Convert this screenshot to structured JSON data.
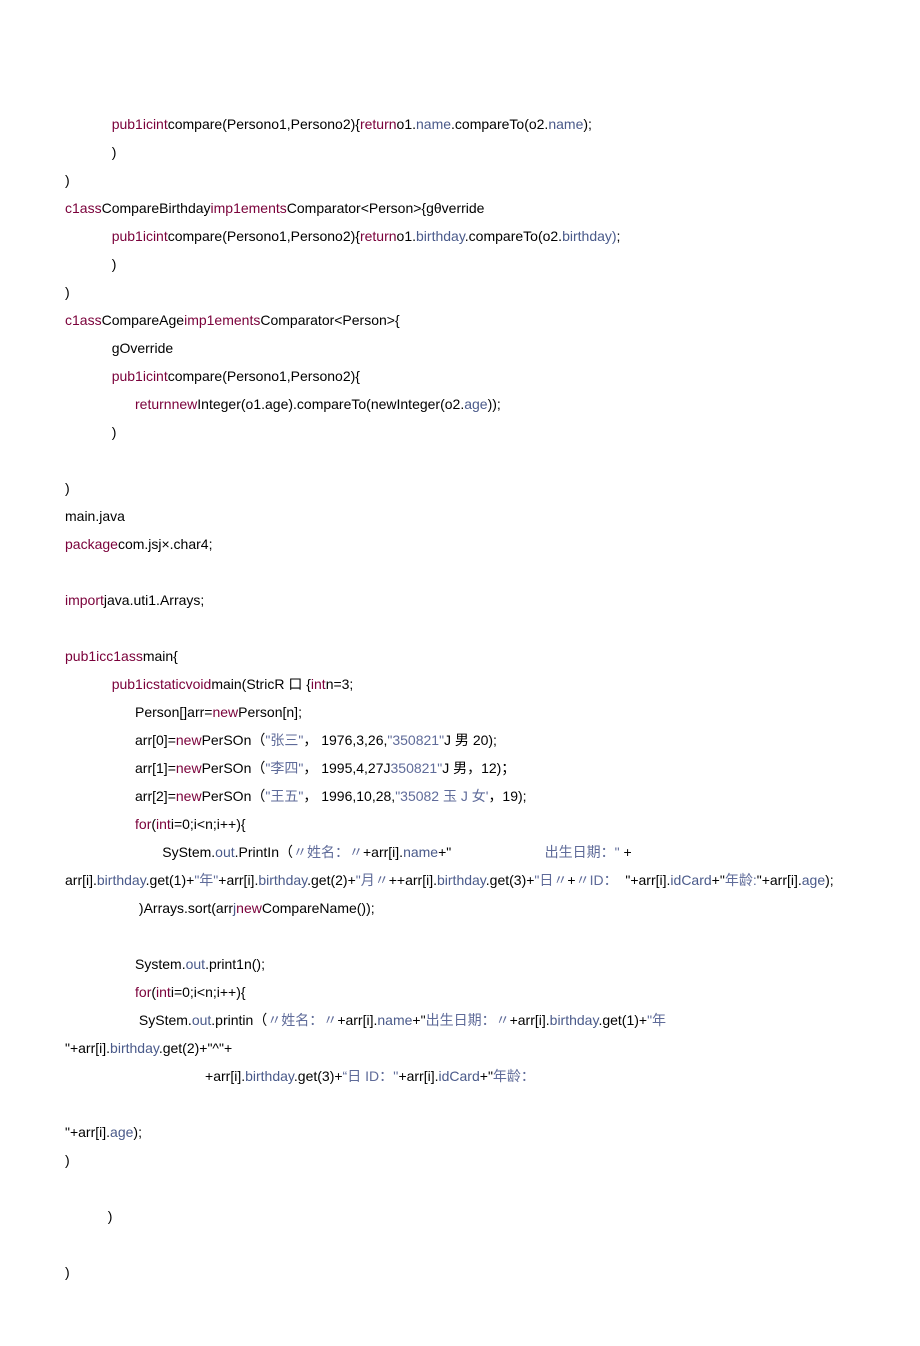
{
  "code_lines": [
    [
      {
        "cls": "plain",
        "txt": "            "
      },
      {
        "cls": "kw",
        "txt": "pub1icint"
      },
      {
        "cls": "plain",
        "txt": "compare(Persono1,Persono2){"
      },
      {
        "cls": "kw",
        "txt": "return"
      },
      {
        "cls": "plain",
        "txt": "o1."
      },
      {
        "cls": "mem",
        "txt": "name"
      },
      {
        "cls": "plain",
        "txt": ".compareTo(o2."
      },
      {
        "cls": "mem",
        "txt": "name"
      },
      {
        "cls": "plain",
        "txt": ");"
      }
    ],
    [
      {
        "cls": "plain",
        "txt": "            )"
      }
    ],
    [
      {
        "cls": "plain",
        "txt": ")"
      }
    ],
    [
      {
        "cls": "kw",
        "txt": "c1ass"
      },
      {
        "cls": "plain",
        "txt": "CompareBirthday"
      },
      {
        "cls": "kw",
        "txt": "imp1ements"
      },
      {
        "cls": "plain",
        "txt": "Comparator<Person>{gθverride"
      }
    ],
    [
      {
        "cls": "plain",
        "txt": "            "
      },
      {
        "cls": "kw",
        "txt": "pub1icint"
      },
      {
        "cls": "plain",
        "txt": "compare(Persono1,Persono2){"
      },
      {
        "cls": "kw",
        "txt": "return"
      },
      {
        "cls": "plain",
        "txt": "o1."
      },
      {
        "cls": "mem",
        "txt": "birthday"
      },
      {
        "cls": "plain",
        "txt": ".compareTo(o2."
      },
      {
        "cls": "mem",
        "txt": "birthday)"
      },
      {
        "cls": "plain",
        "txt": ";"
      }
    ],
    [
      {
        "cls": "plain",
        "txt": "            )"
      }
    ],
    [
      {
        "cls": "plain",
        "txt": ")"
      }
    ],
    [
      {
        "cls": "kw",
        "txt": "c1ass"
      },
      {
        "cls": "plain",
        "txt": "CompareAge"
      },
      {
        "cls": "kw",
        "txt": "imp1ements"
      },
      {
        "cls": "plain",
        "txt": "Comparator<Person>{"
      }
    ],
    [
      {
        "cls": "plain",
        "txt": "            gOverride"
      }
    ],
    [
      {
        "cls": "plain",
        "txt": "            "
      },
      {
        "cls": "kw",
        "txt": "pub1icint"
      },
      {
        "cls": "plain",
        "txt": "compare(Persono1,Persono2){"
      }
    ],
    [
      {
        "cls": "plain",
        "txt": "                  "
      },
      {
        "cls": "kw",
        "txt": "returnnew"
      },
      {
        "cls": "plain",
        "txt": "Integer(o1.age).compareTo(newInteger(o2."
      },
      {
        "cls": "mem",
        "txt": "age"
      },
      {
        "cls": "plain",
        "txt": "));"
      }
    ],
    [
      {
        "cls": "plain",
        "txt": "            )"
      }
    ],
    [
      {
        "cls": "plain",
        "txt": ""
      }
    ],
    [
      {
        "cls": "plain",
        "txt": ")"
      }
    ],
    [
      {
        "cls": "plain",
        "txt": "main.java"
      }
    ],
    [
      {
        "cls": "kw",
        "txt": "package"
      },
      {
        "cls": "plain",
        "txt": "com.jsj×.char4;"
      }
    ],
    [
      {
        "cls": "plain",
        "txt": ""
      }
    ],
    [
      {
        "cls": "kw",
        "txt": "import"
      },
      {
        "cls": "plain",
        "txt": "java.uti1.Arrays;"
      }
    ],
    [
      {
        "cls": "plain",
        "txt": ""
      }
    ],
    [
      {
        "cls": "kw",
        "txt": "pub1icc1ass"
      },
      {
        "cls": "plain",
        "txt": "main{"
      }
    ],
    [
      {
        "cls": "plain",
        "txt": "            "
      },
      {
        "cls": "kw",
        "txt": "pub1icstaticvoid"
      },
      {
        "cls": "plain",
        "txt": "main(StricR 口 {"
      },
      {
        "cls": "kw",
        "txt": "int"
      },
      {
        "cls": "plain",
        "txt": "n=3;"
      }
    ],
    [
      {
        "cls": "plain",
        "txt": "                  Person[]arr="
      },
      {
        "cls": "kw",
        "txt": "new"
      },
      {
        "cls": "plain",
        "txt": "Person[n];"
      }
    ],
    [
      {
        "cls": "plain",
        "txt": "                  arr[0]="
      },
      {
        "cls": "kw",
        "txt": "new"
      },
      {
        "cls": "plain",
        "txt": "PerSOn（"
      },
      {
        "cls": "str",
        "txt": "\"张三\""
      },
      {
        "cls": "plain",
        "txt": "， 1976,3,26,"
      },
      {
        "cls": "str",
        "txt": "\"350821\""
      },
      {
        "cls": "plain",
        "txt": "J 男 20);"
      }
    ],
    [
      {
        "cls": "plain",
        "txt": "                  arr[1]="
      },
      {
        "cls": "kw",
        "txt": "new"
      },
      {
        "cls": "plain",
        "txt": "PerSOn（"
      },
      {
        "cls": "str",
        "txt": "\"李四\""
      },
      {
        "cls": "plain",
        "txt": "， 1995,4,27J"
      },
      {
        "cls": "str",
        "txt": "350821\""
      },
      {
        "cls": "plain",
        "txt": "J 男，12)；"
      }
    ],
    [
      {
        "cls": "plain",
        "txt": "                  arr[2]="
      },
      {
        "cls": "kw",
        "txt": "new"
      },
      {
        "cls": "plain",
        "txt": "PerSOn（"
      },
      {
        "cls": "str",
        "txt": "\"王五\""
      },
      {
        "cls": "plain",
        "txt": "， 1996,10,28,"
      },
      {
        "cls": "str",
        "txt": "\"35082 玉 J 女'"
      },
      {
        "cls": "plain",
        "txt": "，19);"
      }
    ],
    [
      {
        "cls": "plain",
        "txt": "                  "
      },
      {
        "cls": "kw",
        "txt": "for"
      },
      {
        "cls": "plain",
        "txt": "("
      },
      {
        "cls": "kw",
        "txt": "int"
      },
      {
        "cls": "plain",
        "txt": "i=0;i<n;i++){"
      }
    ],
    [
      {
        "cls": "plain",
        "txt": "                         SyStem."
      },
      {
        "cls": "mem",
        "txt": "out"
      },
      {
        "cls": "plain",
        "txt": ".PrintIn（"
      },
      {
        "cls": "str",
        "txt": "〃姓名：〃"
      },
      {
        "cls": "plain",
        "txt": "+arr[i]."
      },
      {
        "cls": "mem",
        "txt": "name"
      },
      {
        "cls": "plain",
        "txt": "+\"                        "
      },
      {
        "cls": "str",
        "txt": "出生日期：\" "
      },
      {
        "cls": "plain",
        "txt": "+"
      }
    ],
    [
      {
        "cls": "plain",
        "txt": "arr[i]."
      },
      {
        "cls": "mem",
        "txt": "birthday"
      },
      {
        "cls": "plain",
        "txt": ".get(1)+"
      },
      {
        "cls": "str",
        "txt": "\"年\""
      },
      {
        "cls": "plain",
        "txt": "+arr[i]."
      },
      {
        "cls": "mem",
        "txt": "birthday"
      },
      {
        "cls": "plain",
        "txt": ".get(2)+"
      },
      {
        "cls": "str",
        "txt": "\"月〃"
      },
      {
        "cls": "plain",
        "txt": "++arr[i]."
      },
      {
        "cls": "mem",
        "txt": "birthday"
      },
      {
        "cls": "plain",
        "txt": ".get(3)+"
      },
      {
        "cls": "str",
        "txt": "\"日〃"
      },
      {
        "cls": "plain",
        "txt": "+"
      },
      {
        "cls": "str",
        "txt": "〃ID："
      },
      {
        "cls": "plain",
        "txt": "  \"+arr[i]."
      },
      {
        "cls": "mem",
        "txt": "idCard"
      },
      {
        "cls": "plain",
        "txt": "+\""
      },
      {
        "cls": "str",
        "txt": "年龄:"
      },
      {
        "cls": "plain",
        "txt": "\"+arr[i]."
      },
      {
        "cls": "mem",
        "txt": "age"
      },
      {
        "cls": "plain",
        "txt": ");"
      }
    ],
    [
      {
        "cls": "plain",
        "txt": "                   )Arrays.sort(arr"
      },
      {
        "cls": "mem",
        "txt": "j"
      },
      {
        "cls": "kw",
        "txt": "new"
      },
      {
        "cls": "plain",
        "txt": "CompareName());"
      }
    ],
    [
      {
        "cls": "plain",
        "txt": ""
      }
    ],
    [
      {
        "cls": "plain",
        "txt": "                  System."
      },
      {
        "cls": "mem",
        "txt": "out"
      },
      {
        "cls": "plain",
        "txt": ".print1n();"
      }
    ],
    [
      {
        "cls": "plain",
        "txt": "                  "
      },
      {
        "cls": "kw",
        "txt": "for"
      },
      {
        "cls": "plain",
        "txt": "("
      },
      {
        "cls": "kw",
        "txt": "int"
      },
      {
        "cls": "plain",
        "txt": "i=0;i<n;i++){"
      }
    ],
    [
      {
        "cls": "plain",
        "txt": "                   SyStem."
      },
      {
        "cls": "mem",
        "txt": "out"
      },
      {
        "cls": "plain",
        "txt": ".printin（"
      },
      {
        "cls": "str",
        "txt": "〃姓名：〃"
      },
      {
        "cls": "plain",
        "txt": "+arr[i]."
      },
      {
        "cls": "mem",
        "txt": "name"
      },
      {
        "cls": "plain",
        "txt": "+\""
      },
      {
        "cls": "str",
        "txt": "出生日期：〃"
      },
      {
        "cls": "plain",
        "txt": "+arr[i]."
      },
      {
        "cls": "mem",
        "txt": "birthday"
      },
      {
        "cls": "plain",
        "txt": ".get(1)+"
      },
      {
        "cls": "str",
        "txt": "\"年"
      }
    ],
    [
      {
        "cls": "plain",
        "txt": "\"+arr[i]."
      },
      {
        "cls": "mem",
        "txt": "birthday"
      },
      {
        "cls": "plain",
        "txt": ".get(2)+\"^\"+"
      }
    ],
    [
      {
        "cls": "plain",
        "txt": "                                    +arr[i]."
      },
      {
        "cls": "mem",
        "txt": "birthday"
      },
      {
        "cls": "plain",
        "txt": ".get(3)+"
      },
      {
        "cls": "str",
        "txt": "“日 ID：''"
      },
      {
        "cls": "plain",
        "txt": "+arr[i]."
      },
      {
        "cls": "mem",
        "txt": "idCard"
      },
      {
        "cls": "plain",
        "txt": "+\""
      },
      {
        "cls": "str",
        "txt": "年龄："
      }
    ],
    [
      {
        "cls": "plain",
        "txt": ""
      }
    ],
    [
      {
        "cls": "plain",
        "txt": "\"+arr[i]."
      },
      {
        "cls": "mem",
        "txt": "age"
      },
      {
        "cls": "plain",
        "txt": ");"
      }
    ],
    [
      {
        "cls": "plain",
        "txt": ")"
      }
    ],
    [
      {
        "cls": "plain",
        "txt": ""
      }
    ],
    [
      {
        "cls": "plain",
        "txt": "           )"
      }
    ],
    [
      {
        "cls": "plain",
        "txt": ""
      }
    ],
    [
      {
        "cls": "plain",
        "txt": ")"
      }
    ]
  ]
}
